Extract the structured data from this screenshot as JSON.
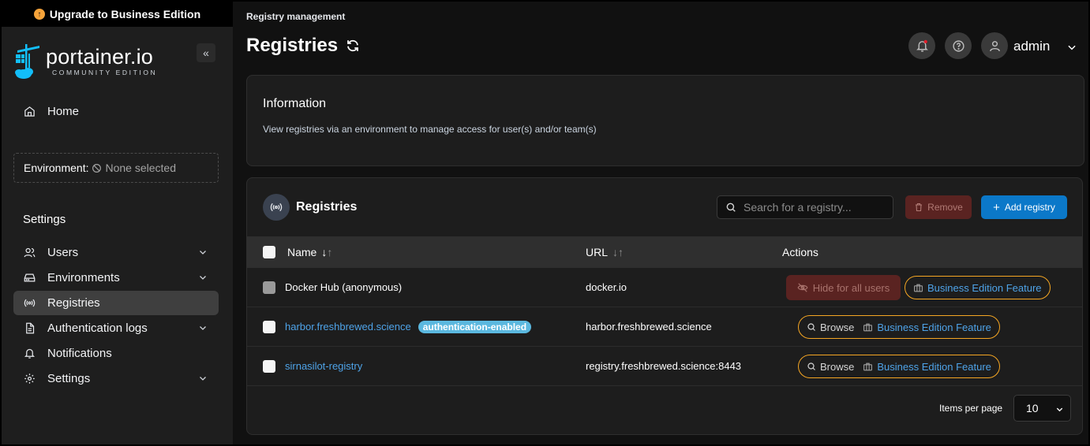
{
  "upgrade_banner": {
    "label": "Upgrade to Business Edition"
  },
  "logo": {
    "name": "portainer.io",
    "edition": "COMMUNITY EDITION"
  },
  "sidebar": {
    "home_label": "Home",
    "environment": {
      "label": "Environment:",
      "value": "None selected"
    },
    "settings_heading": "Settings",
    "items": [
      {
        "label": "Users",
        "icon": "users-icon",
        "expandable": true
      },
      {
        "label": "Environments",
        "icon": "hard-drive-icon",
        "expandable": true
      },
      {
        "label": "Registries",
        "icon": "radio-icon",
        "expandable": false,
        "active": true
      },
      {
        "label": "Authentication logs",
        "icon": "file-text-icon",
        "expandable": true
      },
      {
        "label": "Notifications",
        "icon": "bell-icon",
        "expandable": false
      },
      {
        "label": "Settings",
        "icon": "gear-icon",
        "expandable": true
      }
    ]
  },
  "header": {
    "breadcrumb": "Registry management",
    "title": "Registries",
    "user": "admin"
  },
  "info": {
    "title": "Information",
    "text": "View registries via an environment to manage access for user(s) and/or team(s)"
  },
  "registries": {
    "title": "Registries",
    "search_placeholder": "Search for a registry...",
    "remove_label": "Remove",
    "add_label": "Add registry",
    "columns": {
      "name": "Name",
      "url": "URL",
      "actions": "Actions"
    },
    "rows": [
      {
        "name": "Docker Hub (anonymous)",
        "url": "docker.io",
        "badge": "",
        "action": "Hide for all users",
        "feature": "Business Edition Feature"
      },
      {
        "name": "harbor.freshbrewed.science",
        "url": "harbor.freshbrewed.science",
        "badge": "authentication-enabled",
        "action": "Browse",
        "feature": "Business Edition Feature"
      },
      {
        "name": "sirnasilot-registry",
        "url": "registry.freshbrewed.science:8443",
        "badge": "",
        "action": "Browse",
        "feature": "Business Edition Feature"
      }
    ],
    "items_per_page_label": "Items per page",
    "items_per_page_value": "10"
  },
  "colors": {
    "accent_blue": "#0b78c9",
    "link_blue": "#4ea3e8",
    "business_orange": "#f5a623",
    "danger_dark": "#5a2321",
    "badge_cyan": "#5bb8df"
  }
}
